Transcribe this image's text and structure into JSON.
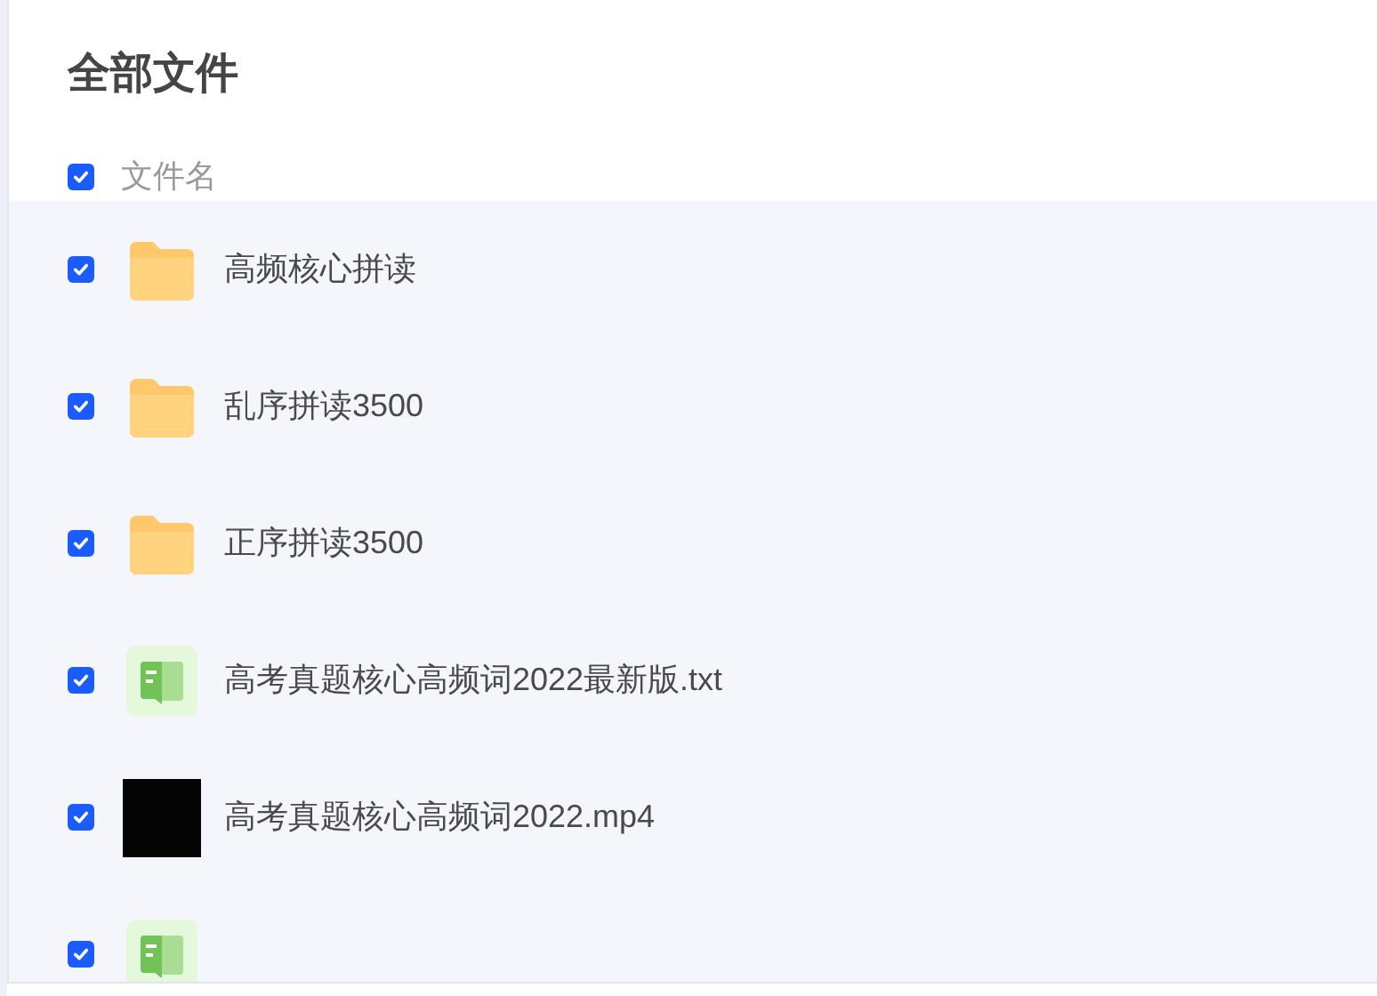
{
  "title": "全部文件",
  "header": {
    "label": "文件名",
    "checked": true
  },
  "files": [
    {
      "kind": "folder",
      "name": "高频核心拼读",
      "checked": true
    },
    {
      "kind": "folder",
      "name": "乱序拼读3500",
      "checked": true
    },
    {
      "kind": "folder",
      "name": "正序拼读3500",
      "checked": true
    },
    {
      "kind": "doc",
      "name": "高考真题核心高频词2022最新版.txt",
      "checked": true
    },
    {
      "kind": "video",
      "name": "高考真题核心高频词2022.mp4",
      "checked": true
    },
    {
      "kind": "doc",
      "checked": true
    }
  ]
}
